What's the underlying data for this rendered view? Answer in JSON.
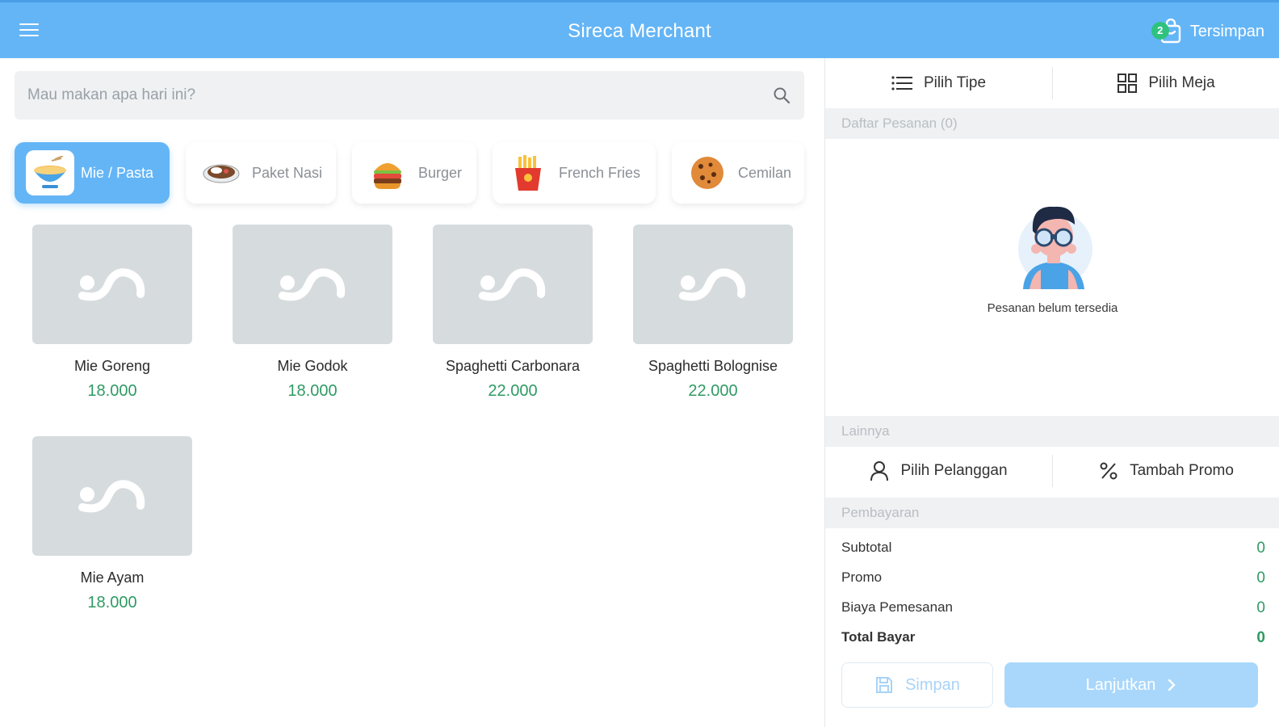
{
  "header": {
    "title": "Sireca Merchant",
    "saved_label": "Tersimpan",
    "saved_count": "2"
  },
  "search": {
    "placeholder": "Mau makan apa hari ini?"
  },
  "categories": [
    {
      "label": "Mie / Pasta",
      "icon": "noodle-bowl-icon",
      "active": true
    },
    {
      "label": "Paket Nasi",
      "icon": "rice-plate-icon",
      "active": false
    },
    {
      "label": "Burger",
      "icon": "burger-icon",
      "active": false
    },
    {
      "label": "French Fries",
      "icon": "french-fries-icon",
      "active": false
    },
    {
      "label": "Cemilan",
      "icon": "cookie-icon",
      "active": false
    }
  ],
  "products": [
    {
      "name": "Mie Goreng",
      "price": "18.000"
    },
    {
      "name": "Mie Godok",
      "price": "18.000"
    },
    {
      "name": "Spaghetti Carbonara",
      "price": "22.000"
    },
    {
      "name": "Spaghetti Bolognise",
      "price": "22.000"
    },
    {
      "name": "Mie Ayam",
      "price": "18.000"
    }
  ],
  "order": {
    "select_type": "Pilih Tipe",
    "select_table": "Pilih Meja",
    "list_header": "Daftar Pesanan (0)",
    "empty_text": "Pesanan belum tersedia",
    "other_header": "Lainnya",
    "select_customer": "Pilih Pelanggan",
    "add_promo": "Tambah Promo",
    "payment_header": "Pembayaran",
    "subtotal_label": "Subtotal",
    "subtotal_value": "0",
    "promo_label": "Promo",
    "promo_value": "0",
    "fee_label": "Biaya Pemesanan",
    "fee_value": "0",
    "total_label": "Total Bayar",
    "total_value": "0",
    "save_label": "Simpan",
    "next_label": "Lanjutkan"
  },
  "colors": {
    "primary": "#64b5f6",
    "price_green": "#2e9b63",
    "badge_green": "#2ec27e",
    "placeholder_bg": "#d6dbde"
  }
}
